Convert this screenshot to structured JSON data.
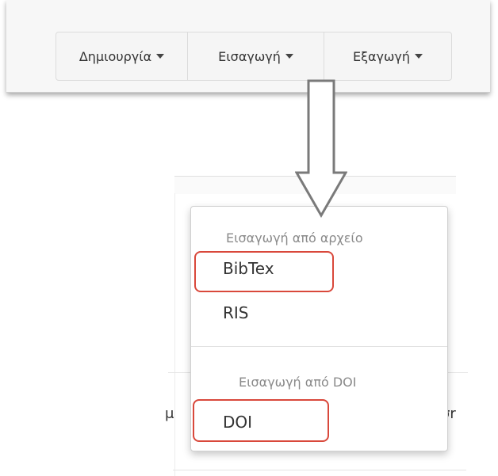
{
  "toolbar": {
    "buttons": [
      {
        "label": "Δημιουργία"
      },
      {
        "label": "Εισαγωγή"
      },
      {
        "label": "Εξαγωγή"
      }
    ]
  },
  "dropdown": {
    "section_file_header": "Εισαγωγή από αρχείο",
    "items_file": [
      "BibTex",
      "RIS"
    ],
    "section_doi_header": "Εισαγωγή από DOI",
    "items_doi": [
      "DOI"
    ]
  },
  "background": {
    "left_fragment": "μ",
    "right_fragment": "σr"
  },
  "colors": {
    "highlight": "#d9483b",
    "toolbar_bg": "#f7f7f7"
  }
}
